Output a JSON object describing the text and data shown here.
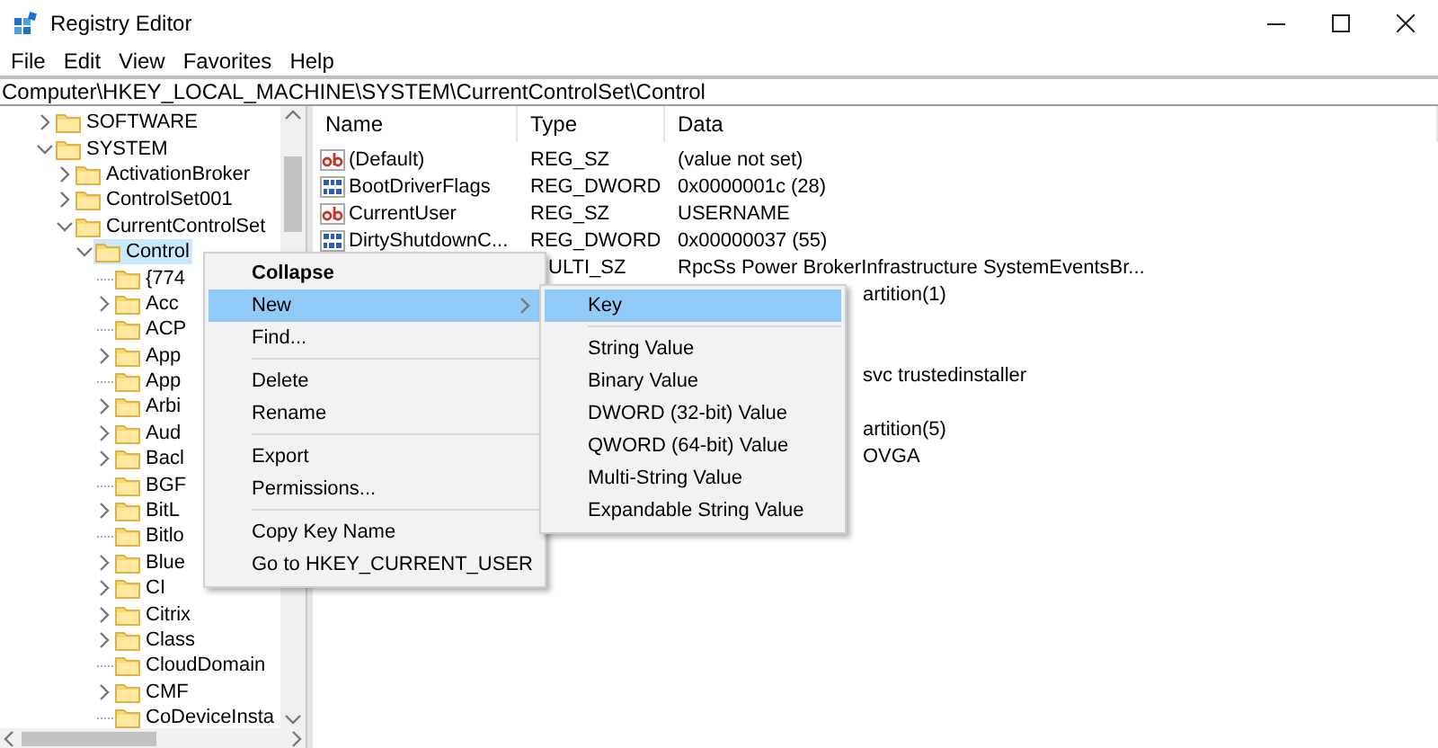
{
  "window": {
    "title": "Registry Editor"
  },
  "menu_bar": [
    "File",
    "Edit",
    "View",
    "Favorites",
    "Help"
  ],
  "address": "Computer\\HKEY_LOCAL_MACHINE\\SYSTEM\\CurrentControlSet\\Control",
  "tree": [
    {
      "label": "SOFTWARE",
      "expandable": true,
      "expanded": false,
      "selected": false
    },
    {
      "label": "SYSTEM",
      "expandable": true,
      "expanded": true,
      "selected": false,
      "children": [
        {
          "label": "ActivationBroker",
          "expandable": true,
          "expanded": false,
          "selected": false
        },
        {
          "label": "ControlSet001",
          "expandable": true,
          "expanded": false,
          "selected": false
        },
        {
          "label": "CurrentControlSet",
          "expandable": true,
          "expanded": true,
          "selected": false,
          "children": [
            {
              "label": "Control",
              "expandable": true,
              "expanded": true,
              "selected": true,
              "children": [
                {
                  "label": "{774",
                  "expandable": false,
                  "selected": false
                },
                {
                  "label": "Acc",
                  "expandable": true,
                  "expanded": false,
                  "selected": false
                },
                {
                  "label": "ACP",
                  "expandable": false,
                  "selected": false
                },
                {
                  "label": "App",
                  "expandable": true,
                  "expanded": false,
                  "selected": false
                },
                {
                  "label": "App",
                  "expandable": false,
                  "selected": false
                },
                {
                  "label": "Arbi",
                  "expandable": true,
                  "expanded": false,
                  "selected": false
                },
                {
                  "label": "Aud",
                  "expandable": true,
                  "expanded": false,
                  "selected": false
                },
                {
                  "label": "Bacl",
                  "expandable": true,
                  "expanded": false,
                  "selected": false
                },
                {
                  "label": "BGF",
                  "expandable": false,
                  "selected": false
                },
                {
                  "label": "BitL",
                  "expandable": true,
                  "expanded": false,
                  "selected": false
                },
                {
                  "label": "Bitlo",
                  "expandable": false,
                  "selected": false
                },
                {
                  "label": "Blue",
                  "expandable": true,
                  "expanded": false,
                  "selected": false
                },
                {
                  "label": "CI",
                  "expandable": true,
                  "expanded": false,
                  "selected": false
                },
                {
                  "label": "Citrix",
                  "expandable": true,
                  "expanded": false,
                  "selected": false
                },
                {
                  "label": "Class",
                  "expandable": true,
                  "expanded": false,
                  "selected": false
                },
                {
                  "label": "CloudDomain",
                  "expandable": false,
                  "selected": false
                },
                {
                  "label": "CMF",
                  "expandable": true,
                  "expanded": false,
                  "selected": false
                },
                {
                  "label": "CoDeviceInsta",
                  "expandable": false,
                  "selected": false
                }
              ]
            }
          ]
        }
      ]
    }
  ],
  "values": {
    "columns": [
      "Name",
      "Type",
      "Data"
    ],
    "rows": [
      {
        "kind": "string",
        "name": "(Default)",
        "type": "REG_SZ",
        "data": "(value not set)"
      },
      {
        "kind": "dword",
        "name": "BootDriverFlags",
        "type": "REG_DWORD",
        "data": "0x0000001c (28)"
      },
      {
        "kind": "string",
        "name": "CurrentUser",
        "type": "REG_SZ",
        "data": "USERNAME"
      },
      {
        "kind": "dword",
        "name": "DirtyShutdownC...",
        "type": "REG_DWORD",
        "data": "0x00000037 (55)"
      },
      {
        "kind": "type_data",
        "type": "ULTI_SZ",
        "data": "RpcSs Power BrokerInfrastructure SystemEventsBr..."
      },
      {
        "kind": "data_only",
        "data": "artition(1)"
      },
      {
        "kind": "covered"
      },
      {
        "kind": "covered"
      },
      {
        "kind": "data_only",
        "data": "svc trustedinstaller"
      },
      {
        "kind": "covered"
      },
      {
        "kind": "data_only",
        "data": "artition(5)"
      },
      {
        "kind": "data_only",
        "data": "OVGA"
      }
    ]
  },
  "context_menu": {
    "groups": [
      [
        {
          "label": "Collapse",
          "bold": true,
          "selected": false,
          "submenu": false
        },
        {
          "label": "New",
          "bold": false,
          "selected": true,
          "submenu": true
        },
        {
          "label": "Find...",
          "bold": false,
          "selected": false,
          "submenu": false
        }
      ],
      [
        {
          "label": "Delete",
          "bold": false,
          "selected": false,
          "submenu": false
        },
        {
          "label": "Rename",
          "bold": false,
          "selected": false,
          "submenu": false
        }
      ],
      [
        {
          "label": "Export",
          "bold": false,
          "selected": false,
          "submenu": false
        },
        {
          "label": "Permissions...",
          "bold": false,
          "selected": false,
          "submenu": false
        }
      ],
      [
        {
          "label": "Copy Key Name",
          "bold": false,
          "selected": false,
          "submenu": false
        },
        {
          "label": "Go to HKEY_CURRENT_USER",
          "bold": false,
          "selected": false,
          "submenu": false
        }
      ]
    ]
  },
  "submenu": {
    "groups": [
      [
        {
          "label": "Key",
          "selected": true
        }
      ],
      [
        {
          "label": "String Value",
          "selected": false
        },
        {
          "label": "Binary Value",
          "selected": false
        },
        {
          "label": "DWORD (32-bit) Value",
          "selected": false
        },
        {
          "label": "QWORD (64-bit) Value",
          "selected": false
        },
        {
          "label": "Multi-String Value",
          "selected": false
        },
        {
          "label": "Expandable String Value",
          "selected": false
        }
      ]
    ]
  }
}
